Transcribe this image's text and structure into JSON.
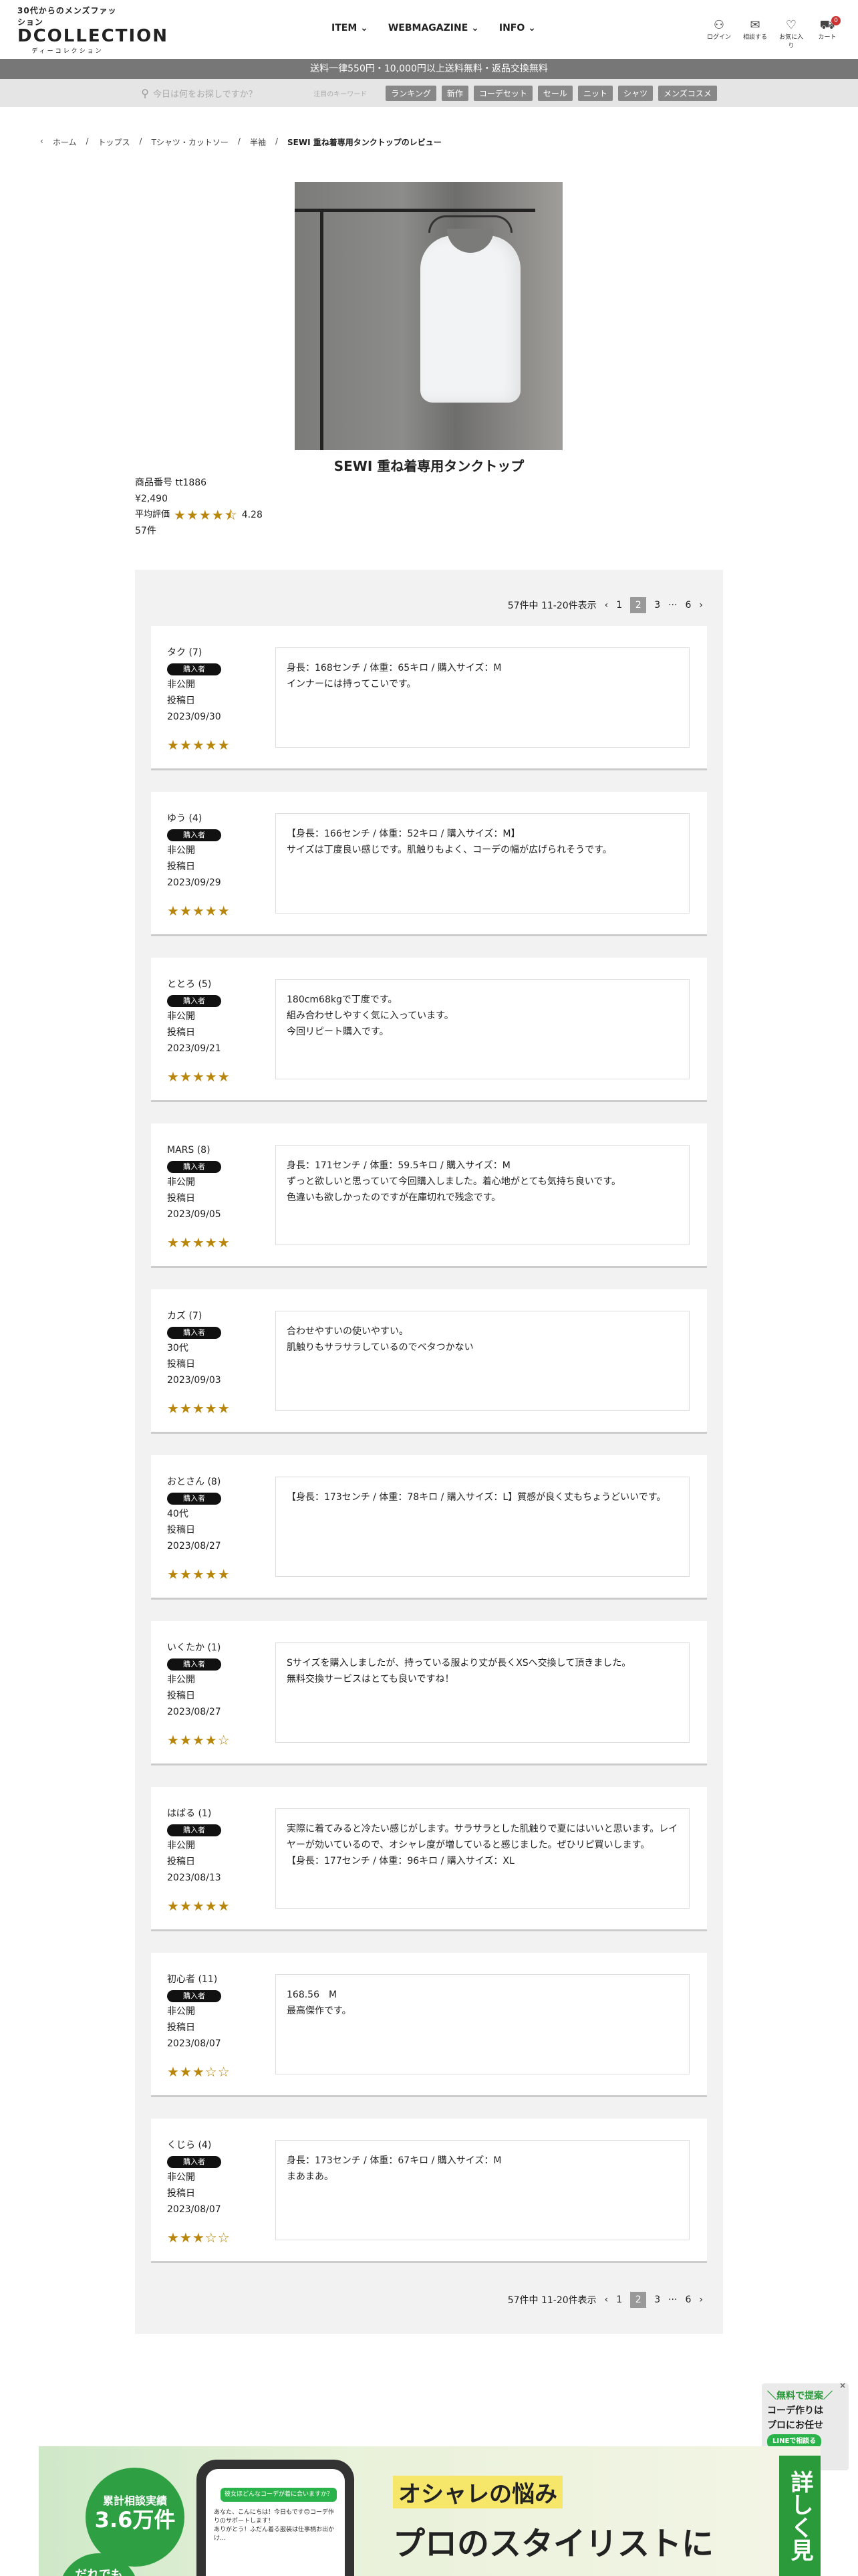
{
  "header": {
    "tagline": "30代からのメンズファッション",
    "logo": "DCOLLECTION",
    "logo_sub": "ディーコレクション",
    "nav": [
      {
        "label": "ITEM ⌄"
      },
      {
        "label": "WEBMAGAZINE ⌄"
      },
      {
        "label": "INFO ⌄"
      }
    ],
    "icons": [
      {
        "label": "ログイン",
        "glyph": "⚇",
        "icon": "login-icon"
      },
      {
        "label": "相談する",
        "glyph": "✉",
        "icon": "chat-icon"
      },
      {
        "label": "お気に入り",
        "glyph": "♡",
        "icon": "heart-icon"
      },
      {
        "label": "カート",
        "glyph": "⛟",
        "icon": "cart-icon"
      }
    ],
    "cart_count": "0"
  },
  "shipbar": "送料一律550円・10,000円以上送料無料・返品交換無料",
  "search": {
    "placeholder": "今日は何をお探しですか？",
    "kw_label": "注目のキーワード",
    "keywords": [
      "ランキング",
      "新作",
      "コーデセット",
      "セール",
      "ニット",
      "シャツ",
      "メンズコスメ"
    ]
  },
  "breadcrumb": [
    "ホーム",
    "トップス",
    "Tシャツ・カットソー",
    "半袖",
    "SEWI 重ね着専用タンクトップのレビュー"
  ],
  "product": {
    "name": "SEWI 重ね着専用タンクトップ",
    "code": "商品番号 tt1886",
    "price": "¥2,490",
    "avg_label": "平均評価",
    "avg_stars": "★★★★⯪",
    "avg_value": "4.28",
    "count": "57件"
  },
  "pager": {
    "summary": "57件中 11-20件表示",
    "prev": "‹",
    "pages": [
      "1",
      "2",
      "3",
      "···",
      "6"
    ],
    "current": "2",
    "next": "›"
  },
  "reviews": [
    {
      "name": "タク (7)",
      "badge": "購入者",
      "age": "非公開",
      "posted": "投稿日",
      "date": "2023/09/30",
      "stars": "★★★★★",
      "text": "身長：168センチ / 体重：65キロ / 購入サイズ：M\nインナーには持ってこいです。"
    },
    {
      "name": "ゆう (4)",
      "badge": "購入者",
      "age": "非公開",
      "posted": "投稿日",
      "date": "2023/09/29",
      "stars": "★★★★★",
      "text": "【身長：166センチ / 体重：52キロ / 購入サイズ：M】\nサイズは丁度良い感じです。肌触りもよく、コーデの幅が広げられそうです。"
    },
    {
      "name": "ととろ (5)",
      "badge": "購入者",
      "age": "非公開",
      "posted": "投稿日",
      "date": "2023/09/21",
      "stars": "★★★★★",
      "text": "180cm68kgで丁度です。\n組み合わせしやすく気に入っています。\n今回リピート購入です。"
    },
    {
      "name": "MARS (8)",
      "badge": "購入者",
      "age": "非公開",
      "posted": "投稿日",
      "date": "2023/09/05",
      "stars": "★★★★★",
      "text": "身長：171センチ / 体重：59.5キロ / 購入サイズ：M\nずっと欲しいと思っていて今回購入しました。着心地がとても気持ち良いです。\n色違いも欲しかったのですが在庫切れで残念です。"
    },
    {
      "name": "カズ (7)",
      "badge": "購入者",
      "age": "30代",
      "posted": "投稿日",
      "date": "2023/09/03",
      "stars": "★★★★★",
      "text": "合わせやすいの使いやすい。\n肌触りもサラサラしているのでベタつかない"
    },
    {
      "name": "おとさん (8)",
      "badge": "購入者",
      "age": "40代",
      "posted": "投稿日",
      "date": "2023/08/27",
      "stars": "★★★★★",
      "text": "【身長：173センチ / 体重：78キロ / 購入サイズ：L】質感が良く丈もちょうどいいです。"
    },
    {
      "name": "いくたか (1)",
      "badge": "購入者",
      "age": "非公開",
      "posted": "投稿日",
      "date": "2023/08/27",
      "stars": "★★★★☆",
      "text": "Sサイズを購入しましたが、持っている服より丈が長くXSへ交換して頂きました。\n無料交換サービスはとても良いですね！"
    },
    {
      "name": "はばる (1)",
      "badge": "購入者",
      "age": "非公開",
      "posted": "投稿日",
      "date": "2023/08/13",
      "stars": "★★★★★",
      "text": "実際に着てみると冷たい感じがします。サラサラとした肌触りで夏にはいいと思います。レイヤーが効いているので、オシャレ度が増していると感じました。ぜひリピ買いします。\n【身長：177センチ / 体重：96キロ / 購入サイズ：XL"
    },
    {
      "name": "初心者 (11)",
      "badge": "購入者",
      "age": "非公開",
      "posted": "投稿日",
      "date": "2023/08/07",
      "stars": "★★★☆☆",
      "text": "168.56　M\n最高傑作です。"
    },
    {
      "name": "くじら (4)",
      "badge": "購入者",
      "age": "非公開",
      "posted": "投稿日",
      "date": "2023/08/07",
      "stars": "★★★☆☆",
      "text": "身長：173センチ / 体重：67キロ / 購入サイズ：M\nまあまあ。"
    }
  ],
  "floating": {
    "line1": "＼無料で提案／",
    "line2": "コーデ作りは",
    "line3": "プロにお任せ",
    "btn": "LINEで相談る",
    "close": "×"
  },
  "banner": {
    "badge_top": "累計相談実績",
    "badge_num": "3.6万件",
    "badge2": "だれでも",
    "phone_header": "彼女ほどんなコーデが着に合いますか？",
    "phone_msg": "あなた、こんにちは！今日もです😊コーデ作りのサポートします！",
    "phone_reply": "ありがとう！ふだん着る服装は仕事柄お出かけ...",
    "headline1": "オシャレの悩み",
    "headline2": "プロのスタイリストに",
    "side": "詳しく見"
  }
}
